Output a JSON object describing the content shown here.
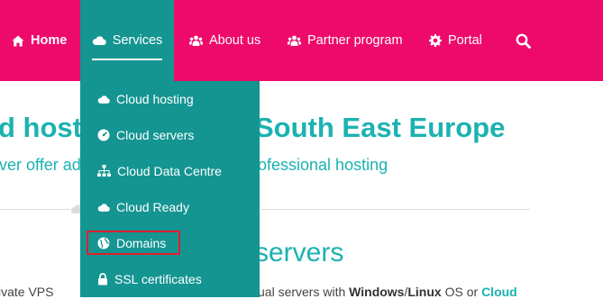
{
  "nav": {
    "home": "Home",
    "services": "Services",
    "about": "About us",
    "partner": "Partner program",
    "portal": "Portal"
  },
  "dropdown": {
    "items": [
      {
        "label": "Cloud hosting",
        "icon": "cloud-icon"
      },
      {
        "label": "Cloud servers",
        "icon": "dashboard-icon"
      },
      {
        "label": "Cloud Data Centre",
        "icon": "sitemap-icon"
      },
      {
        "label": "Cloud Ready",
        "icon": "cloud-icon"
      },
      {
        "label": "Domains",
        "icon": "globe-icon"
      },
      {
        "label": "SSL certificates",
        "icon": "lock-icon"
      }
    ]
  },
  "hero": {
    "title_left": "d host",
    "title_right": "South East Europe",
    "subtitle_left": "ver offer ad",
    "subtitle_right": "ofessional hosting"
  },
  "section": {
    "title": "l servers",
    "left_text": "ivate VPS",
    "right_text_prefix": "ual servers with ",
    "windows": "Windows",
    "slash": "/",
    "linux": "Linux",
    "os_or": " OS or ",
    "cloud": "Cloud"
  },
  "colors": {
    "nav_bg": "#ee0a6b",
    "dropdown_bg": "#149592",
    "accent": "#1bb2b1",
    "highlight": "#e01e2c"
  }
}
